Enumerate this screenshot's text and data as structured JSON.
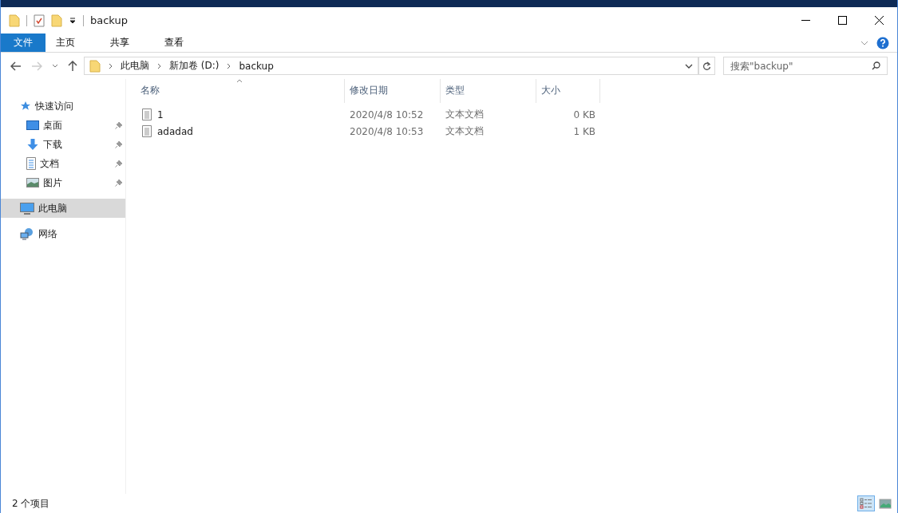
{
  "window": {
    "title": "backup"
  },
  "ribbon_tabs": [
    {
      "label": "文件",
      "kind": "file",
      "selected": false
    },
    {
      "label": "主页",
      "kind": "tab",
      "selected": false
    },
    {
      "label": "共享",
      "kind": "tab",
      "selected": false
    },
    {
      "label": "查看",
      "kind": "tab",
      "selected": false
    }
  ],
  "address_bar": {
    "crumbs": [
      "此电脑",
      "新加卷 (D:)",
      "backup"
    ]
  },
  "search": {
    "placeholder": "搜索\"backup\""
  },
  "sidebar": {
    "items": [
      {
        "label": "快速访问",
        "kind": "star",
        "selected": false,
        "children": [
          {
            "label": "桌面",
            "kind": "desktop",
            "pinned": true,
            "selected": false
          },
          {
            "label": "下载",
            "kind": "download",
            "pinned": true,
            "selected": false
          },
          {
            "label": "文档",
            "kind": "document",
            "pinned": true,
            "selected": false
          },
          {
            "label": "图片",
            "kind": "picture",
            "pinned": true,
            "selected": false
          }
        ]
      },
      {
        "label": "此电脑",
        "kind": "computer",
        "selected": true
      },
      {
        "label": "网络",
        "kind": "network",
        "selected": false
      }
    ]
  },
  "table": {
    "columns": [
      "名称",
      "修改日期",
      "类型",
      "大小"
    ],
    "rows": [
      {
        "name": "1",
        "modified": "2020/4/8 10:52",
        "type": "文本文档",
        "size": "0 KB",
        "selected": false
      },
      {
        "name": "adadad",
        "modified": "2020/4/8 10:53",
        "type": "文本文档",
        "size": "1 KB",
        "selected": false
      }
    ]
  },
  "status_bar": {
    "count": "2 个项目",
    "view_buttons": [
      {
        "kind": "details",
        "selected": true
      },
      {
        "kind": "tiles",
        "selected": false
      }
    ]
  }
}
